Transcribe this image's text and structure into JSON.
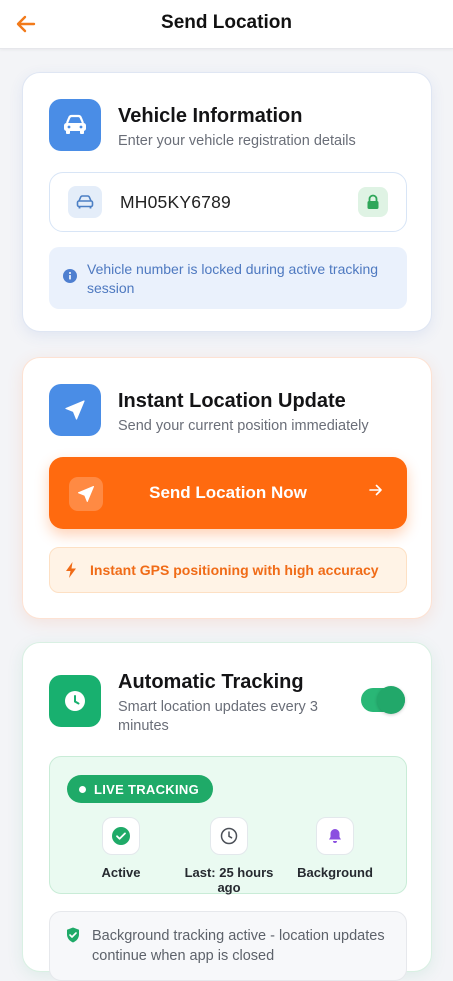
{
  "header": {
    "title": "Send Location"
  },
  "vehicle_card": {
    "title": "Vehicle Information",
    "subtitle": "Enter your vehicle registration details",
    "vehicle_number": "MH05KY6789",
    "note": "Vehicle number is locked during active tracking session"
  },
  "instant_card": {
    "title": "Instant Location Update",
    "subtitle": "Send your current position immediately",
    "button_label": "Send Location Now",
    "note": "Instant GPS positioning with high accuracy"
  },
  "tracking_card": {
    "title": "Automatic Tracking",
    "subtitle": "Smart location updates every 3 minutes",
    "toggle_on": true,
    "badge": "LIVE TRACKING",
    "stats": [
      {
        "label": "Active"
      },
      {
        "label": "Last: 25 hours ago"
      },
      {
        "label": "Background"
      }
    ],
    "note": "Background tracking active - location updates continue when app is closed"
  },
  "colors": {
    "accent_orange": "#ff6a0f",
    "brand_blue": "#4a8de6",
    "brand_green": "#18b06f"
  },
  "icons": [
    "arrow-left-icon",
    "car-icon",
    "lock-icon",
    "info-icon",
    "navigation-icon",
    "arrow-right-icon",
    "bolt-icon",
    "clock-icon",
    "check-icon",
    "bell-icon",
    "shield-icon"
  ]
}
